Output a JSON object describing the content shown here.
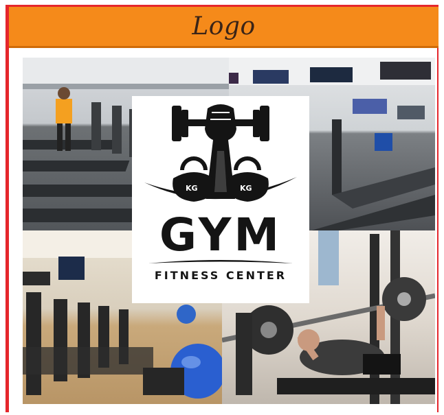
{
  "header": {
    "title": "Logo"
  },
  "logo": {
    "kg_left": "KG",
    "kg_right": "KG",
    "gym_text": "GYM",
    "subtitle": "FITNESS CENTER"
  },
  "colors": {
    "header_bg": "#f58a1a",
    "frame_border": "#e5262c",
    "title_text": "#3a2417",
    "logo_ink": "#141414"
  },
  "photos": [
    {
      "name": "treadmill-room-left"
    },
    {
      "name": "treadmill-room-right"
    },
    {
      "name": "cardio-machines-room"
    },
    {
      "name": "bench-press-person"
    }
  ]
}
